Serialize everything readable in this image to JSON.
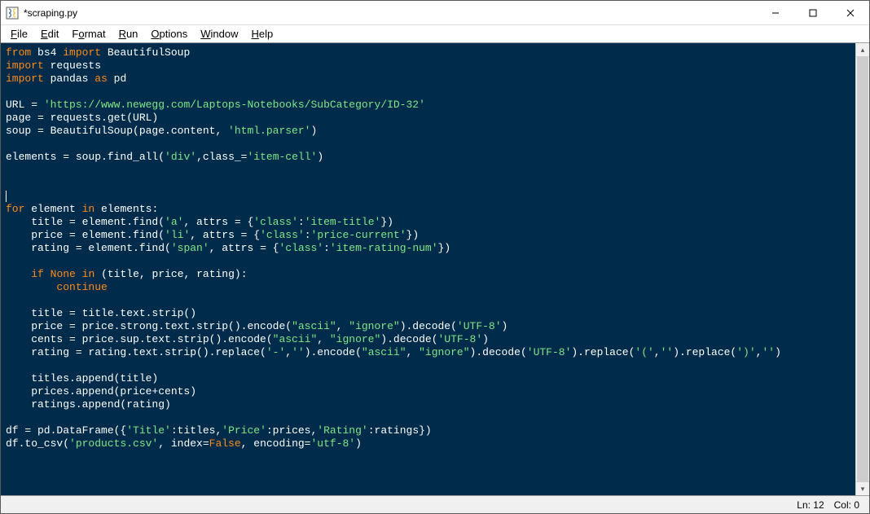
{
  "window": {
    "title": "*scraping.py"
  },
  "menubar": {
    "items": [
      {
        "label": "File",
        "ul": "F"
      },
      {
        "label": "Edit",
        "ul": "E"
      },
      {
        "label": "Format",
        "ul": "o"
      },
      {
        "label": "Run",
        "ul": "R"
      },
      {
        "label": "Options",
        "ul": "O"
      },
      {
        "label": "Window",
        "ul": "W"
      },
      {
        "label": "Help",
        "ul": "H"
      }
    ]
  },
  "statusbar": {
    "line": "Ln: 12",
    "col": "Col: 0"
  },
  "win_buttons": {
    "minimize": "—",
    "maximize": "▢",
    "close": "✕"
  },
  "scrollbar": {
    "up": "▴",
    "down": "▾"
  },
  "code": {
    "lines": [
      [
        {
          "cls": "kw",
          "t": "from"
        },
        {
          "t": " bs4 "
        },
        {
          "cls": "kw",
          "t": "import"
        },
        {
          "t": " BeautifulSoup"
        }
      ],
      [
        {
          "cls": "kw",
          "t": "import"
        },
        {
          "t": " requests"
        }
      ],
      [
        {
          "cls": "kw",
          "t": "import"
        },
        {
          "t": " pandas "
        },
        {
          "cls": "kw",
          "t": "as"
        },
        {
          "t": " pd"
        }
      ],
      [
        {
          "t": ""
        }
      ],
      [
        {
          "t": "URL = "
        },
        {
          "cls": "str",
          "t": "'https://www.newegg.com/Laptops-Notebooks/SubCategory/ID-32'"
        }
      ],
      [
        {
          "t": "page = requests.get(URL)"
        }
      ],
      [
        {
          "t": "soup = BeautifulSoup(page.content, "
        },
        {
          "cls": "str",
          "t": "'html.parser'"
        },
        {
          "t": ")"
        }
      ],
      [
        {
          "t": ""
        }
      ],
      [
        {
          "t": "elements = soup.find_all("
        },
        {
          "cls": "str",
          "t": "'div'"
        },
        {
          "t": ",class_="
        },
        {
          "cls": "str",
          "t": "'item-cell'"
        },
        {
          "t": ")"
        }
      ],
      [
        {
          "t": ""
        }
      ],
      [
        {
          "t": ""
        }
      ],
      [
        {
          "cls": "cursor",
          "t": ""
        }
      ],
      [
        {
          "cls": "kw",
          "t": "for"
        },
        {
          "t": " element "
        },
        {
          "cls": "kw",
          "t": "in"
        },
        {
          "t": " elements:"
        }
      ],
      [
        {
          "t": "    title = element.find("
        },
        {
          "cls": "str",
          "t": "'a'"
        },
        {
          "t": ", attrs = {"
        },
        {
          "cls": "str",
          "t": "'class'"
        },
        {
          "t": ":"
        },
        {
          "cls": "str",
          "t": "'item-title'"
        },
        {
          "t": "})"
        }
      ],
      [
        {
          "t": "    price = element.find("
        },
        {
          "cls": "str",
          "t": "'li'"
        },
        {
          "t": ", attrs = {"
        },
        {
          "cls": "str",
          "t": "'class'"
        },
        {
          "t": ":"
        },
        {
          "cls": "str",
          "t": "'price-current'"
        },
        {
          "t": "})"
        }
      ],
      [
        {
          "t": "    rating = element.find("
        },
        {
          "cls": "str",
          "t": "'span'"
        },
        {
          "t": ", attrs = {"
        },
        {
          "cls": "str",
          "t": "'class'"
        },
        {
          "t": ":"
        },
        {
          "cls": "str",
          "t": "'item-rating-num'"
        },
        {
          "t": "})"
        }
      ],
      [
        {
          "t": ""
        }
      ],
      [
        {
          "t": "    "
        },
        {
          "cls": "kw",
          "t": "if"
        },
        {
          "t": " "
        },
        {
          "cls": "kw",
          "t": "None"
        },
        {
          "t": " "
        },
        {
          "cls": "kw",
          "t": "in"
        },
        {
          "t": " (title, price, rating):"
        }
      ],
      [
        {
          "t": "        "
        },
        {
          "cls": "kw",
          "t": "continue"
        }
      ],
      [
        {
          "t": ""
        }
      ],
      [
        {
          "t": "    title = title.text.strip()"
        }
      ],
      [
        {
          "t": "    price = price.strong.text.strip().encode("
        },
        {
          "cls": "str",
          "t": "\"ascii\""
        },
        {
          "t": ", "
        },
        {
          "cls": "str",
          "t": "\"ignore\""
        },
        {
          "t": ").decode("
        },
        {
          "cls": "str",
          "t": "'UTF-8'"
        },
        {
          "t": ")"
        }
      ],
      [
        {
          "t": "    cents = price.sup.text.strip().encode("
        },
        {
          "cls": "str",
          "t": "\"ascii\""
        },
        {
          "t": ", "
        },
        {
          "cls": "str",
          "t": "\"ignore\""
        },
        {
          "t": ").decode("
        },
        {
          "cls": "str",
          "t": "'UTF-8'"
        },
        {
          "t": ")"
        }
      ],
      [
        {
          "t": "    rating = rating.text.strip().replace("
        },
        {
          "cls": "str",
          "t": "'-'"
        },
        {
          "t": ","
        },
        {
          "cls": "str",
          "t": "''"
        },
        {
          "t": ").encode("
        },
        {
          "cls": "str",
          "t": "\"ascii\""
        },
        {
          "t": ", "
        },
        {
          "cls": "str",
          "t": "\"ignore\""
        },
        {
          "t": ").decode("
        },
        {
          "cls": "str",
          "t": "'UTF-8'"
        },
        {
          "t": ").replace("
        },
        {
          "cls": "str",
          "t": "'('"
        },
        {
          "t": ","
        },
        {
          "cls": "str",
          "t": "''"
        },
        {
          "t": ").replace("
        },
        {
          "cls": "str",
          "t": "')'"
        },
        {
          "t": ","
        },
        {
          "cls": "str",
          "t": "''"
        },
        {
          "t": ")"
        }
      ],
      [
        {
          "t": ""
        }
      ],
      [
        {
          "t": "    titles.append(title)"
        }
      ],
      [
        {
          "t": "    prices.append(price+cents)"
        }
      ],
      [
        {
          "t": "    ratings.append(rating)"
        }
      ],
      [
        {
          "t": ""
        }
      ],
      [
        {
          "t": "df = pd.DataFrame({"
        },
        {
          "cls": "str",
          "t": "'Title'"
        },
        {
          "t": ":titles,"
        },
        {
          "cls": "str",
          "t": "'Price'"
        },
        {
          "t": ":prices,"
        },
        {
          "cls": "str",
          "t": "'Rating'"
        },
        {
          "t": ":ratings})"
        }
      ],
      [
        {
          "t": "df.to_csv("
        },
        {
          "cls": "str",
          "t": "'products.csv'"
        },
        {
          "t": ", index="
        },
        {
          "cls": "kw",
          "t": "False"
        },
        {
          "t": ", encoding="
        },
        {
          "cls": "str",
          "t": "'utf-8'"
        },
        {
          "t": ")"
        }
      ],
      [
        {
          "t": ""
        }
      ]
    ]
  }
}
